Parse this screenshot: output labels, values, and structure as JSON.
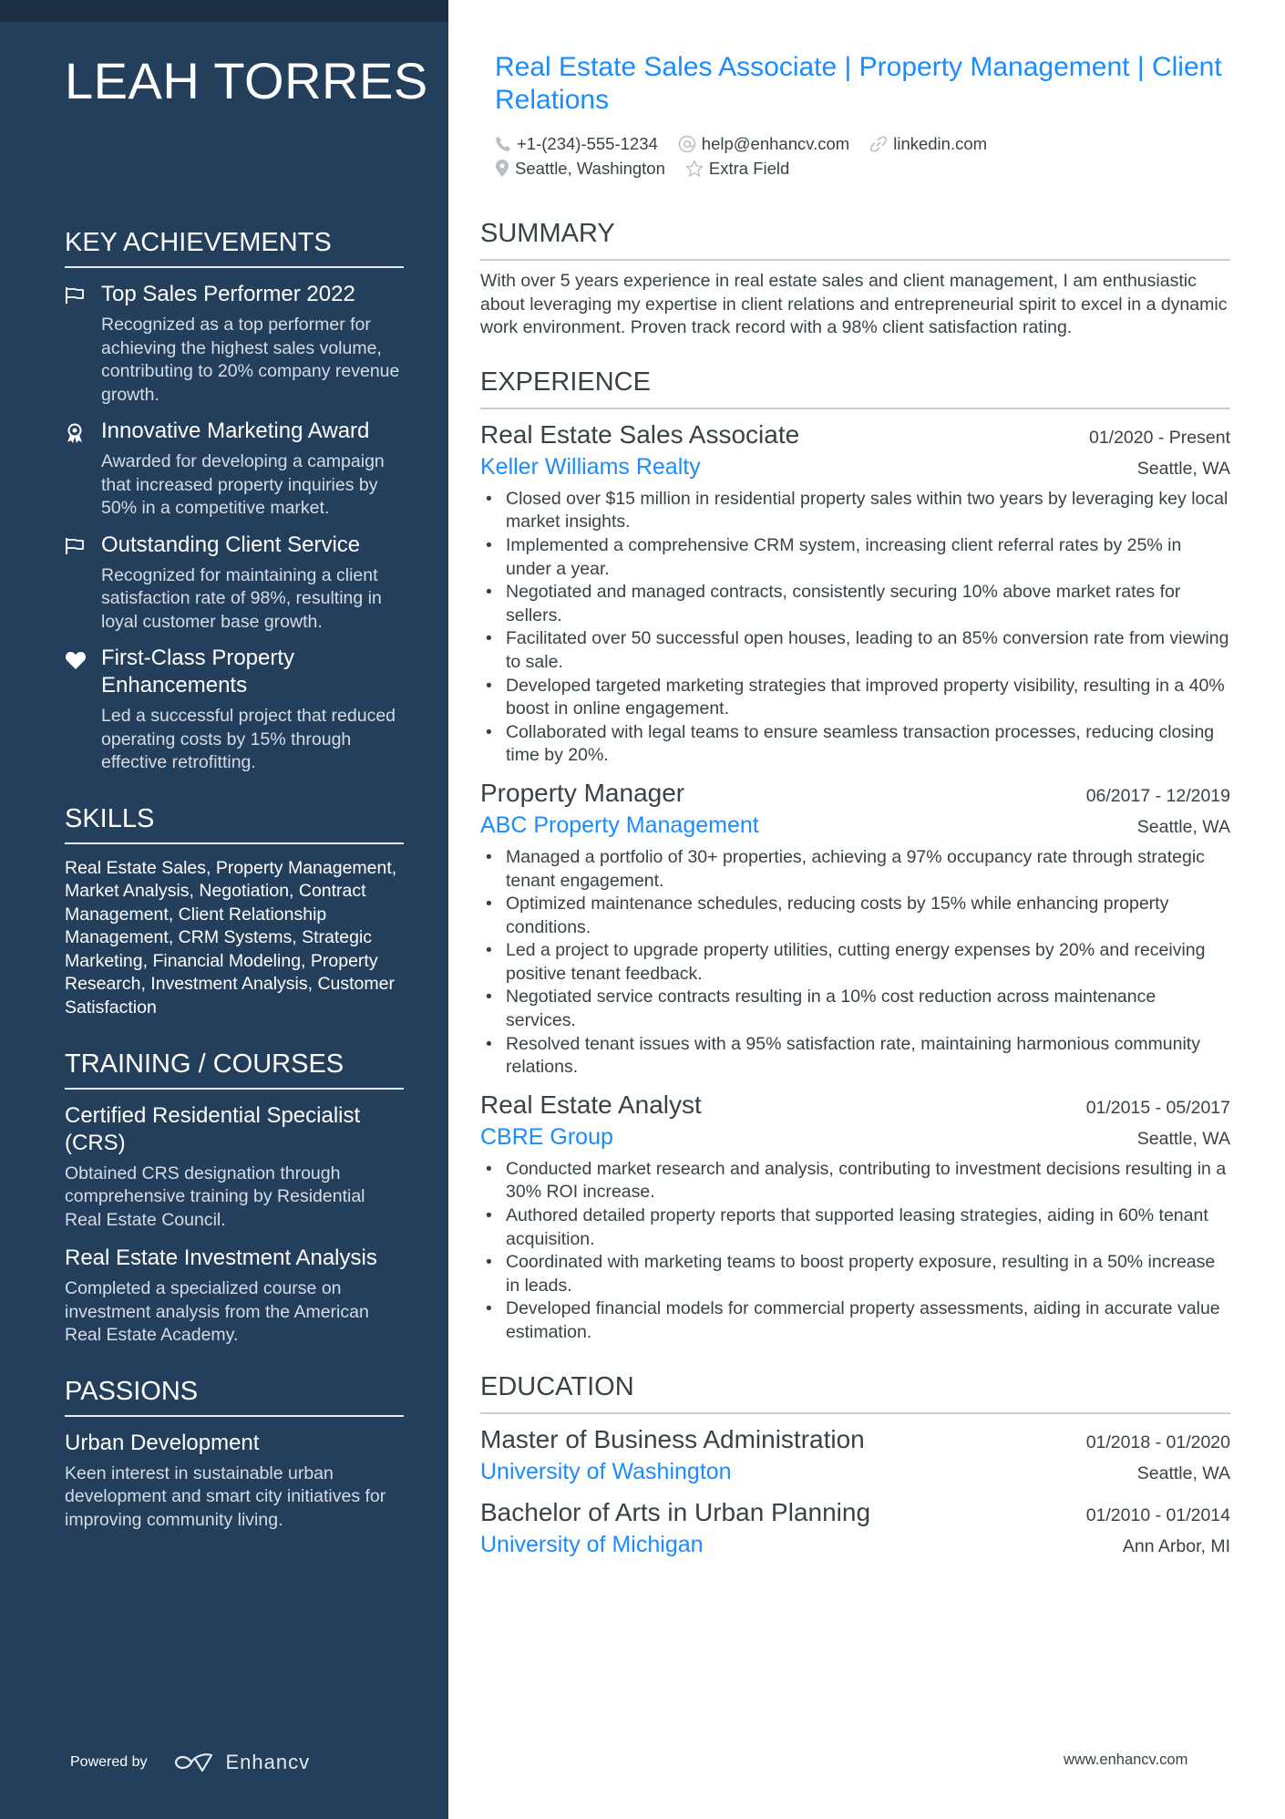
{
  "profile": {
    "name": "LEAH TORRES",
    "headline": "Real Estate Sales Associate | Property Management | Client Relations",
    "contacts": {
      "phone": "+1-(234)-555-1234",
      "email": "help@enhancv.com",
      "link": "linkedin.com",
      "location": "Seattle, Washington",
      "extra": "Extra Field"
    }
  },
  "sidebar": {
    "achievements": {
      "heading": "KEY ACHIEVEMENTS",
      "items": [
        {
          "icon": "flag-icon",
          "title": "Top Sales Performer 2022",
          "desc": "Recognized as a top performer for achieving the highest sales volume, contributing to 20% company revenue growth."
        },
        {
          "icon": "award-ribbon-icon",
          "title": "Innovative Marketing Award",
          "desc": "Awarded for developing a campaign that increased property inquiries by 50% in a competitive market."
        },
        {
          "icon": "flag-icon",
          "title": "Outstanding Client Service",
          "desc": "Recognized for maintaining a client satisfaction rate of 98%, resulting in loyal customer base growth."
        },
        {
          "icon": "heart-icon",
          "title": "First-Class Property Enhancements",
          "desc": "Led a successful project that reduced operating costs by 15% through effective retrofitting."
        }
      ]
    },
    "skills": {
      "heading": "SKILLS",
      "text": "Real Estate Sales, Property Management, Market Analysis, Negotiation, Contract Management, Client Relationship Management, CRM Systems, Strategic Marketing, Financial Modeling, Property Research, Investment Analysis, Customer Satisfaction"
    },
    "training": {
      "heading": "TRAINING / COURSES",
      "items": [
        {
          "title": "Certified Residential Specialist (CRS)",
          "desc": "Obtained CRS designation through comprehensive training by Residential Real Estate Council."
        },
        {
          "title": "Real Estate Investment Analysis",
          "desc": "Completed a specialized course on investment analysis from the American Real Estate Academy."
        }
      ]
    },
    "passions": {
      "heading": "PASSIONS",
      "items": [
        {
          "title": "Urban Development",
          "desc": "Keen interest in sustainable urban development and smart city initiatives for improving community living."
        }
      ]
    },
    "powered_by": "Powered by",
    "brand": "Enhancv"
  },
  "main": {
    "summary": {
      "heading": "SUMMARY",
      "text": "With over 5 years experience in real estate sales and client management, I am enthusiastic about leveraging my expertise in client relations and entrepreneurial spirit to excel in a dynamic work environment. Proven track record with a 98% client satisfaction rating."
    },
    "experience": {
      "heading": "EXPERIENCE",
      "jobs": [
        {
          "title": "Real Estate Sales Associate",
          "dates": "01/2020 - Present",
          "company": "Keller Williams Realty",
          "location": "Seattle, WA",
          "bullets": [
            "Closed over $15 million in residential property sales within two years by leveraging key local market insights.",
            "Implemented a comprehensive CRM system, increasing client referral rates by 25% in under a year.",
            "Negotiated and managed contracts, consistently securing 10% above market rates for sellers.",
            "Facilitated over 50 successful open houses, leading to an 85% conversion rate from viewing to sale.",
            "Developed targeted marketing strategies that improved property visibility, resulting in a 40% boost in online engagement.",
            "Collaborated with legal teams to ensure seamless transaction processes, reducing closing time by 20%."
          ]
        },
        {
          "title": "Property Manager",
          "dates": "06/2017 - 12/2019",
          "company": "ABC Property Management",
          "location": "Seattle, WA",
          "bullets": [
            "Managed a portfolio of 30+ properties, achieving a 97% occupancy rate through strategic tenant engagement.",
            "Optimized maintenance schedules, reducing costs by 15% while enhancing property conditions.",
            "Led a project to upgrade property utilities, cutting energy expenses by 20% and receiving positive tenant feedback.",
            "Negotiated service contracts resulting in a 10% cost reduction across maintenance services.",
            "Resolved tenant issues with a 95% satisfaction rate, maintaining harmonious community relations."
          ]
        },
        {
          "title": "Real Estate Analyst",
          "dates": "01/2015 - 05/2017",
          "company": "CBRE Group",
          "location": "Seattle, WA",
          "bullets": [
            "Conducted market research and analysis, contributing to investment decisions resulting in a 30% ROI increase.",
            "Authored detailed property reports that supported leasing strategies, aiding in 60% tenant acquisition.",
            "Coordinated with marketing teams to boost property exposure, resulting in a 50% increase in leads.",
            "Developed financial models for commercial property assessments, aiding in accurate value estimation."
          ]
        }
      ]
    },
    "education": {
      "heading": "EDUCATION",
      "items": [
        {
          "degree": "Master of Business Administration",
          "dates": "01/2018 - 01/2020",
          "school": "University of Washington",
          "location": "Seattle, WA"
        },
        {
          "degree": "Bachelor of Arts in Urban Planning",
          "dates": "01/2010 - 01/2014",
          "school": "University of Michigan",
          "location": "Ann Arbor, MI"
        }
      ]
    }
  },
  "footer": {
    "url": "www.enhancv.com"
  },
  "colors": {
    "sidebar": "#233f5c",
    "sidebar_top": "#1b2d42",
    "accent": "#1a8cff",
    "text": "#384347"
  }
}
